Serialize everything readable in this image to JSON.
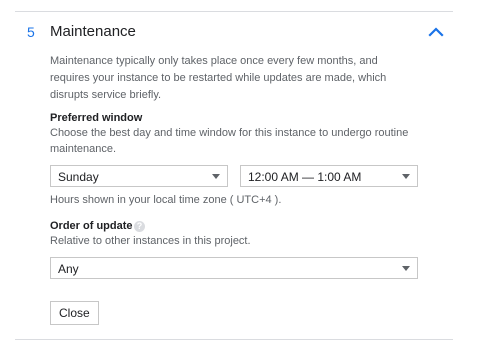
{
  "section": {
    "number": "5",
    "title": "Maintenance",
    "description": "Maintenance typically only takes place once every few months, and requires your instance to be restarted while updates are made, which disrupts service briefly."
  },
  "preferred_window": {
    "label": "Preferred window",
    "help": "Choose the best day and time window for this instance to undergo routine maintenance.",
    "day_value": "Sunday",
    "time_value": "12:00 AM — 1:00 AM",
    "timezone_note": "Hours shown in your local time zone ( UTC+4 )."
  },
  "order_of_update": {
    "label": "Order of update",
    "help": "Relative to other instances in this project.",
    "value": "Any",
    "help_icon": "?"
  },
  "actions": {
    "close_label": "Close"
  },
  "icons": {
    "collapse": "chevron-up-icon",
    "help": "help-circle-icon"
  },
  "colors": {
    "accent": "#1a73e8",
    "muted_text": "#5f6368",
    "border": "#c7c7c7"
  }
}
